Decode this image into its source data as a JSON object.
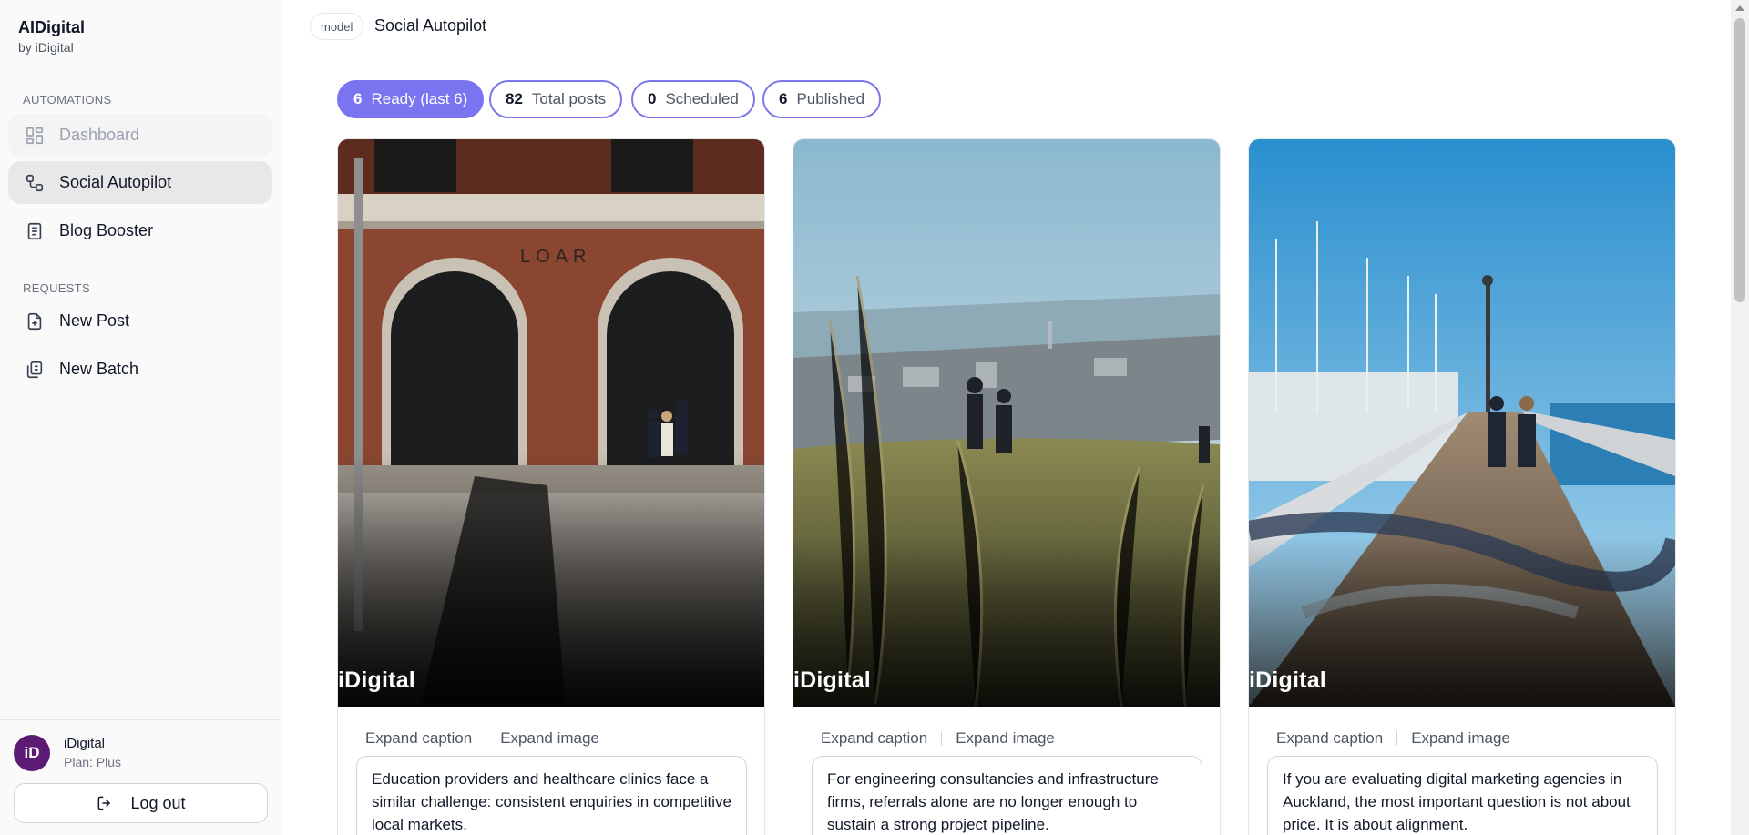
{
  "brand": {
    "name": "AIDigital",
    "sub": "by iDigital"
  },
  "sidebar": {
    "automations_label": "AUTOMATIONS",
    "requests_label": "REQUESTS",
    "items": [
      {
        "label": "Dashboard",
        "icon": "dashboard-grid-icon",
        "state": "disabled"
      },
      {
        "label": "Social Autopilot",
        "icon": "share-nodes-icon",
        "state": "active"
      },
      {
        "label": "Blog Booster",
        "icon": "document-icon",
        "state": "normal"
      },
      {
        "label": "New Post",
        "icon": "file-plus-icon",
        "state": "normal"
      },
      {
        "label": "New Batch",
        "icon": "copy-files-icon",
        "state": "normal"
      }
    ]
  },
  "user": {
    "avatar": "iD",
    "name": "iDigital",
    "plan": "Plan: Plus",
    "logout_label": "Log out"
  },
  "header": {
    "model_tag": "model",
    "title": "Social Autopilot"
  },
  "stats": [
    {
      "num": "6",
      "label": "Ready (last 6)",
      "active": true
    },
    {
      "num": "82",
      "label": "Total posts",
      "active": false
    },
    {
      "num": "0",
      "label": "Scheduled",
      "active": false
    },
    {
      "num": "6",
      "label": "Published",
      "active": false
    }
  ],
  "cards": [
    {
      "watermark": "iDigital",
      "expand_caption": "Expand caption",
      "expand_image": "Expand image",
      "caption": "Education providers and healthcare clinics face a similar challenge: consistent enquiries in competitive local markets.",
      "sign_text": "LOAR"
    },
    {
      "watermark": "iDigital",
      "expand_caption": "Expand caption",
      "expand_image": "Expand image",
      "caption": "For engineering consultancies and infrastructure firms, referrals alone are no longer enough to sustain a strong project pipeline."
    },
    {
      "watermark": "iDigital",
      "expand_caption": "Expand caption",
      "expand_image": "Expand image",
      "caption": "If you are evaluating digital marketing agencies in Auckland, the most important question is not about price. It is about alignment."
    }
  ],
  "colors": {
    "accent": "#7b74f0",
    "avatar_bg": "#5b1a73"
  }
}
